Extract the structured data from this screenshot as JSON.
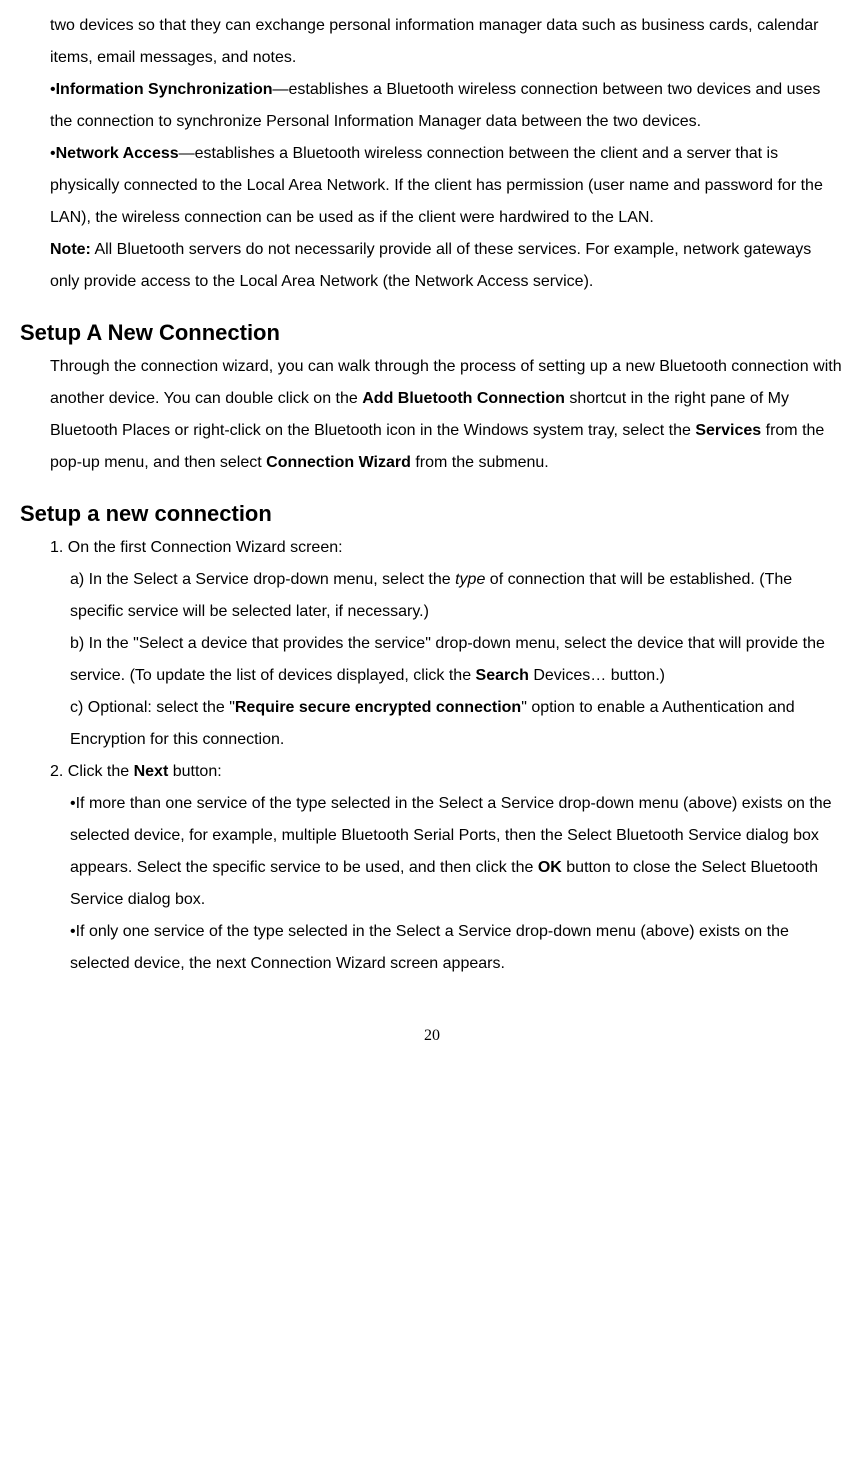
{
  "para1": "two devices so that they can exchange personal information manager data such as business cards, calendar items, email messages, and notes.",
  "para2_bullet": "•",
  "para2_bold": "Information Synchronization",
  "para2_rest": "—establishes a Bluetooth wireless connection between two devices and uses the connection to synchronize Personal Information Manager data between the two devices.",
  "para3_bullet": "•",
  "para3_bold": "Network Access",
  "para3_rest": "—establishes a Bluetooth wireless connection between the client and a server that is physically connected to the Local Area Network. If the client has permission (user name and password for the LAN), the wireless connection can be used as if the client were hardwired to the LAN.",
  "para4_bold": "Note:",
  "para4_rest": " All Bluetooth servers do not necessarily provide all of these services. For example, network gateways only provide access to the Local Area Network (the Network Access service).",
  "heading1": "Setup A New Connection",
  "para5_a": "Through the connection wizard, you can walk through the process of setting up a new Bluetooth connection with another device. You can double click on the ",
  "para5_b_bold": "Add Bluetooth Connection",
  "para5_c": " shortcut in the right pane of My Bluetooth Places or right-click on the Bluetooth icon in the Windows system tray, select the ",
  "para5_d_bold": "Services",
  "para5_e": " from the pop-up menu, and then select ",
  "para5_f_bold": "Connection Wizard",
  "para5_g": " from the submenu.",
  "heading2": "Setup a new connection",
  "step1": "1. On the first Connection Wizard screen:",
  "step1a_a": "a) In the Select a Service drop-down menu, select the ",
  "step1a_b_italic": "type",
  "step1a_c": " of connection that will be established. (The specific service will be selected later, if necessary.)",
  "step1b_a": "b) In the \"Select a device that provides the service\" drop-down menu, select the device that will provide the service. (To update the list of devices displayed, click the ",
  "step1b_b_bold": "Search",
  "step1b_c": " Devices… button.)",
  "step1c_a": "c) Optional: select the \"",
  "step1c_b_bold": "Require secure encrypted connection",
  "step1c_c": "\" option to enable a Authentication and Encryption for this connection.",
  "step2_a": "2. Click the ",
  "step2_b_bold": "Next",
  "step2_c": " button:",
  "step2bullet1_a": "•If more than one service of the type selected in the Select a Service drop-down menu (above) exists on the selected device, for example, multiple Bluetooth Serial Ports, then the Select Bluetooth Service dialog box appears. Select the specific service to be used, and then click the ",
  "step2bullet1_b_bold": "OK",
  "step2bullet1_c": " button to close the Select Bluetooth Service dialog box.",
  "step2bullet2": "•If only one service of the type selected in the Select a Service drop-down menu (above) exists on the selected device, the next Connection Wizard screen appears.",
  "page_number": "20"
}
